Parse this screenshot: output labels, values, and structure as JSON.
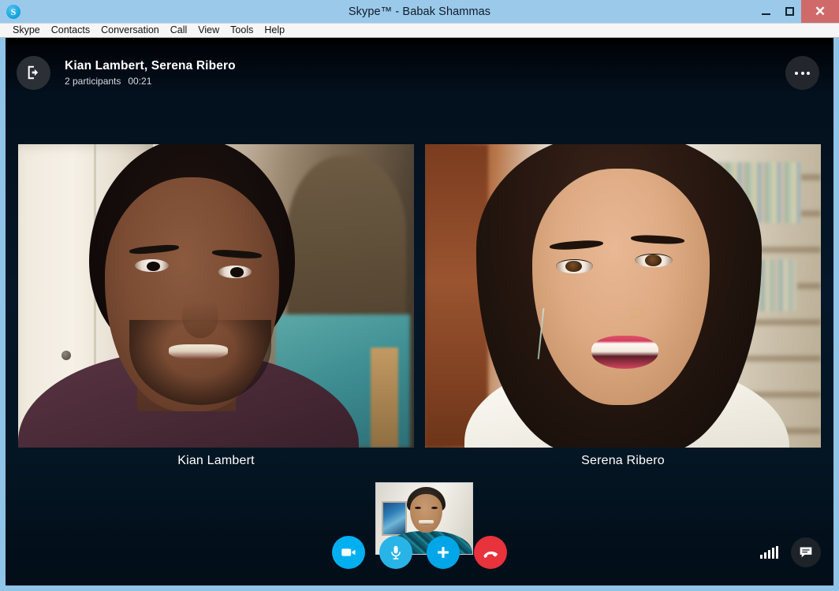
{
  "window": {
    "title": "Skype™ - Babak Shammas",
    "logo_icon": "skype-logo-icon",
    "logo_letter": "S",
    "controls": {
      "minimize": "minimize-icon",
      "maximize": "maximize-icon",
      "close_label": "✕"
    }
  },
  "menubar": {
    "items": [
      {
        "label": "Skype"
      },
      {
        "label": "Contacts"
      },
      {
        "label": "Conversation"
      },
      {
        "label": "Call"
      },
      {
        "label": "View"
      },
      {
        "label": "Tools"
      },
      {
        "label": "Help"
      }
    ]
  },
  "call_header": {
    "leave_icon": "exit-call-icon",
    "title": "Kian Lambert, Serena Ribero",
    "participants": "2 participants",
    "duration": "00:21",
    "more_icon": "more-options-icon"
  },
  "participants": [
    {
      "name": "Kian Lambert",
      "video_on": true
    },
    {
      "name": "Serena Ribero",
      "video_on": true
    }
  ],
  "self_view": {
    "label": "Babak Shammas",
    "video_on": true
  },
  "controls": {
    "buttons": [
      {
        "name": "video-toggle-button",
        "icon": "video-camera-icon",
        "color": "#00aff0"
      },
      {
        "name": "mute-toggle-button",
        "icon": "microphone-icon",
        "color": "#29b4e8"
      },
      {
        "name": "add-participant-button",
        "icon": "plus-icon",
        "color": "#00a6e8"
      },
      {
        "name": "end-call-button",
        "icon": "hangup-phone-icon",
        "color": "#e8323c"
      }
    ],
    "signal_icon": "signal-strength-icon",
    "chat_icon": "chat-bubble-icon"
  },
  "colors": {
    "titlebar": "#9bc9ea",
    "window_border": "#8fc3e8",
    "call_background": "#051728",
    "skype_blue": "#00aff0",
    "hangup_red": "#e8323c",
    "close_red": "#d06a6a"
  }
}
